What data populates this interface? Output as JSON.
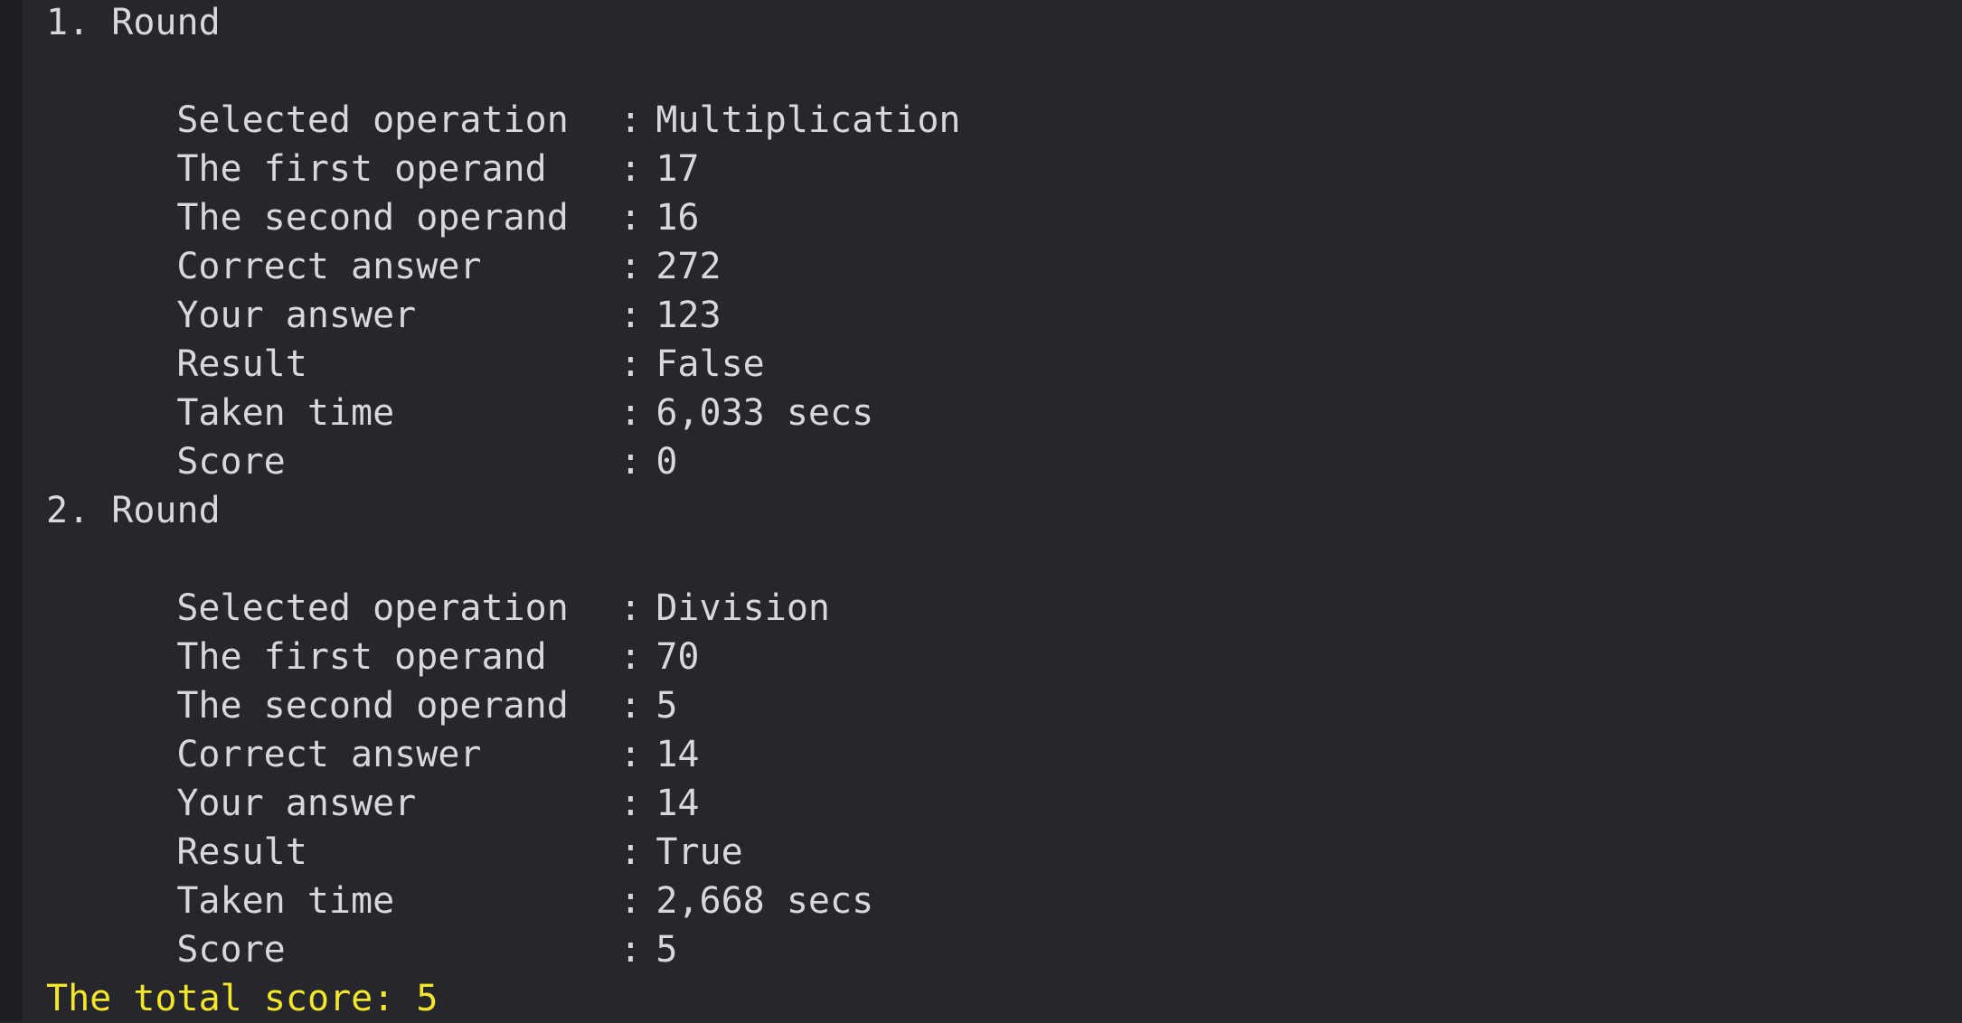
{
  "rounds": [
    {
      "header": "1. Round",
      "rows": [
        {
          "label": "Selected operation",
          "value": "Multiplication"
        },
        {
          "label": "The first operand",
          "value": "17"
        },
        {
          "label": "The second operand",
          "value": "16"
        },
        {
          "label": "Correct answer",
          "value": "272"
        },
        {
          "label": "Your answer",
          "value": "123"
        },
        {
          "label": "Result",
          "value": "False"
        },
        {
          "label": "Taken time",
          "value": "6,033 secs"
        },
        {
          "label": "Score",
          "value": "0"
        }
      ]
    },
    {
      "header": "2. Round",
      "rows": [
        {
          "label": "Selected operation",
          "value": "Division"
        },
        {
          "label": "The first operand",
          "value": "70"
        },
        {
          "label": "The second operand",
          "value": "5"
        },
        {
          "label": "Correct answer",
          "value": "14"
        },
        {
          "label": "Your answer",
          "value": "14"
        },
        {
          "label": "Result",
          "value": "True"
        },
        {
          "label": "Taken time",
          "value": "2,668 secs"
        },
        {
          "label": "Score",
          "value": "5"
        }
      ]
    }
  ],
  "separator": ":",
  "total_score_line": "The total score: 5",
  "colors": {
    "background": "#26272c",
    "text": "#d7d8dc",
    "highlight": "#f4e62b"
  }
}
